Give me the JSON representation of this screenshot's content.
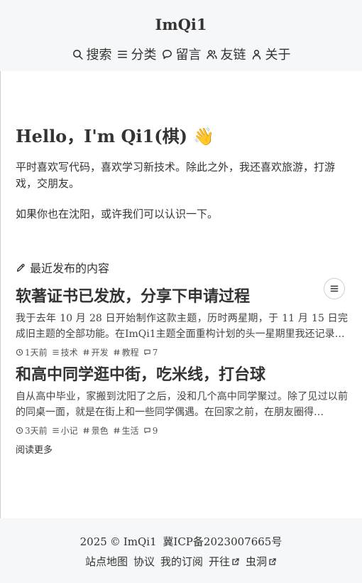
{
  "header": {
    "site_title": "ImQi1",
    "nav": [
      {
        "label": "搜索",
        "icon": "search-icon"
      },
      {
        "label": "分类",
        "icon": "menu-icon"
      },
      {
        "label": "留言",
        "icon": "chat-bubble-icon"
      },
      {
        "label": "友链",
        "icon": "friends-icon"
      },
      {
        "label": "关于",
        "icon": "user-icon"
      }
    ]
  },
  "intro": {
    "greeting": "Hello，I'm Qi1(棋) 👋",
    "paragraph1": "平时喜欢写代码，喜欢学习新技术。除此之外，我还喜欢旅游，打游戏，交朋友。",
    "paragraph2": "如果你也在沈阳，或许我们可以认识一下。"
  },
  "recent": {
    "heading": "最近发布的内容",
    "heading_icon": "pencil-icon",
    "toc_icon": "list-icon",
    "posts": [
      {
        "title": "软著证书已发放，分享下申请过程",
        "excerpt": "我于去年 10 月 28 日开始制作这款主题，历时两星期，于 11 月 15 日完成旧主题的全部功能。在ImQi1主题全面重构计划的头一星期里我还记录…",
        "time": "1天前",
        "category": "技术",
        "tags": [
          "开发",
          "教程"
        ],
        "comments": "7"
      },
      {
        "title": "和高中同学逛中街，吃米线，打台球",
        "excerpt": "自从高中毕业，家搬到沈阳了之后，没和几个高中同学聚过。除了见过以前的同桌一面，就是在街上和一些同学偶遇。在回家之前，在朋友圈得…",
        "time": "3天前",
        "category": "小记",
        "tags": [
          "景色",
          "生活"
        ],
        "comments": "9"
      }
    ],
    "read_more": "阅读更多"
  },
  "footer": {
    "year": "2025",
    "copyright_symbol": "©",
    "owner": "ImQi1",
    "icp": "冀ICP备2023007665号",
    "links": [
      {
        "label": "站点地图",
        "external": false
      },
      {
        "label": "协议",
        "external": false
      },
      {
        "label": "我的订阅",
        "external": false
      },
      {
        "label": "开往",
        "external": true
      },
      {
        "label": "虫洞",
        "external": true
      }
    ]
  }
}
